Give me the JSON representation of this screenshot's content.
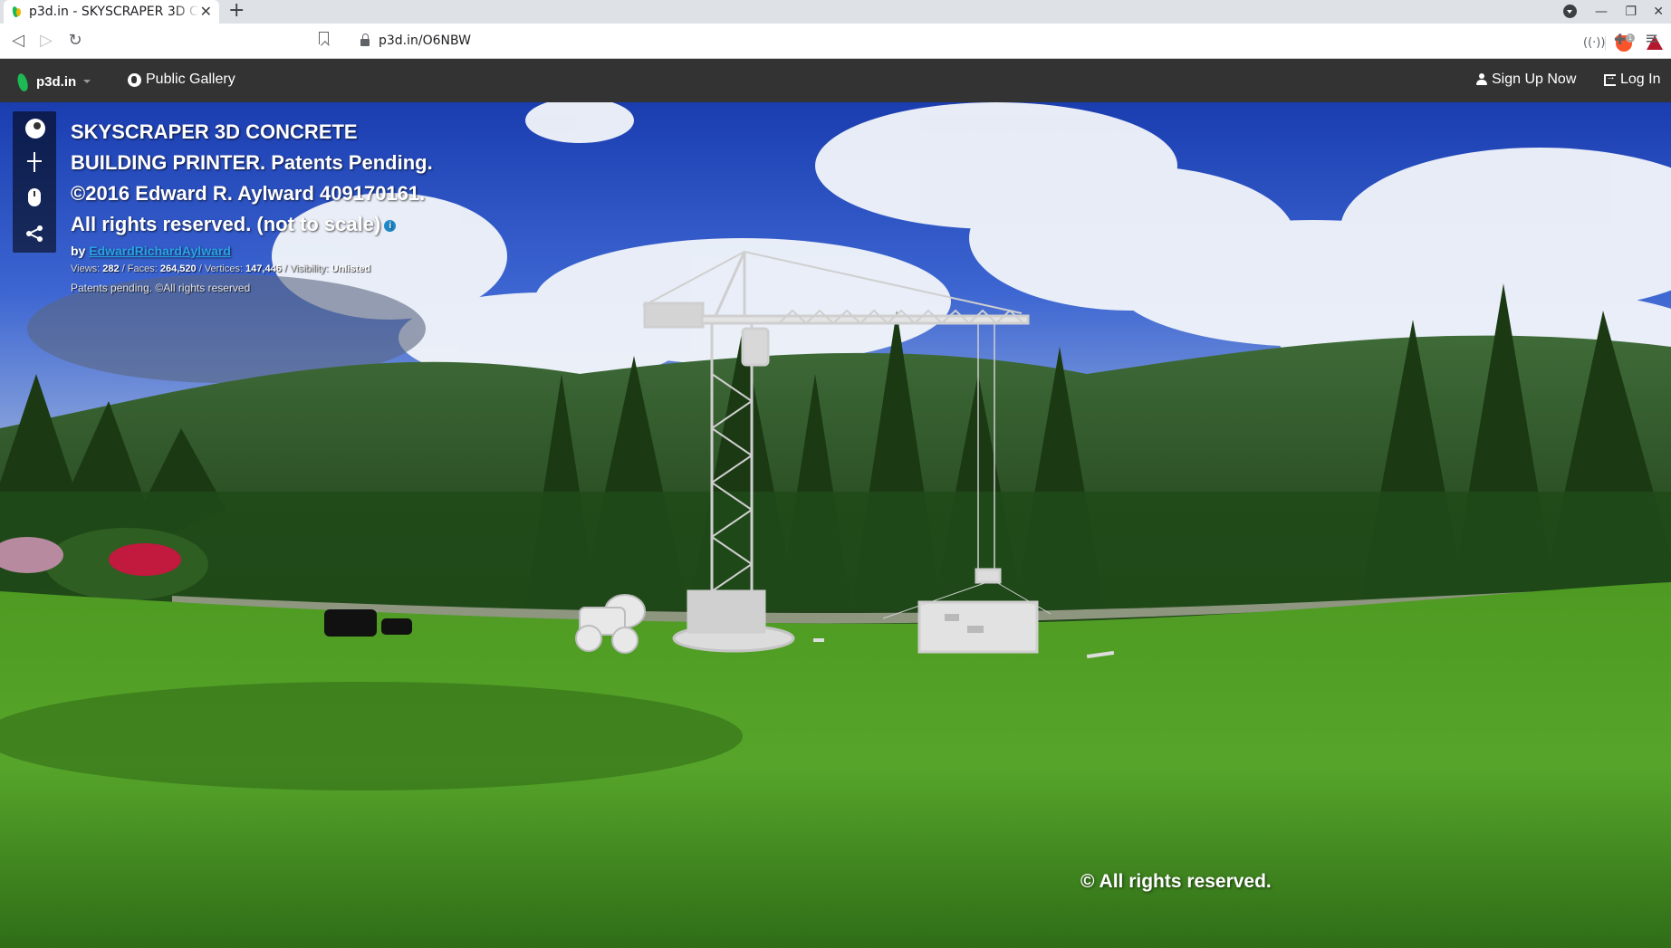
{
  "browser": {
    "tab_title": "p3d.in - SKYSCRAPER 3D C",
    "tab_close": "✕",
    "new_tab": "+",
    "url": "p3d.in/O6NBW",
    "brave_badge": "1"
  },
  "site_header": {
    "brand": "p3d.in",
    "public_gallery": "Public Gallery",
    "sign_up": "Sign Up Now",
    "log_in": "Log In"
  },
  "model": {
    "title": "SKYSCRAPER 3D CONCRETE BUILDING PRINTER. Patents Pending. ©2016 Edward R. Aylward 409170161. All rights reserved. (not to scale)",
    "by_label": "by",
    "author": "EdwardRichardAylward",
    "stats": {
      "views_label": "Views:",
      "views": "282",
      "faces_label": "/ Faces:",
      "faces": "264,520",
      "vertices_label": "/ Vertices:",
      "vertices": "147,446",
      "visibility_label": "/ Visibility:",
      "visibility": "Unlisted"
    },
    "note": "Patents pending. ©All rights reserved"
  },
  "scene": {
    "copyright": "© All rights reserved."
  },
  "icons": {
    "info": "i",
    "back": "◁",
    "forward": "▷",
    "reload": "↻",
    "signal": "((·))",
    "puzzle": "✚",
    "menu": "≡",
    "minimize": "—",
    "restore": "❐",
    "close": "✕"
  }
}
